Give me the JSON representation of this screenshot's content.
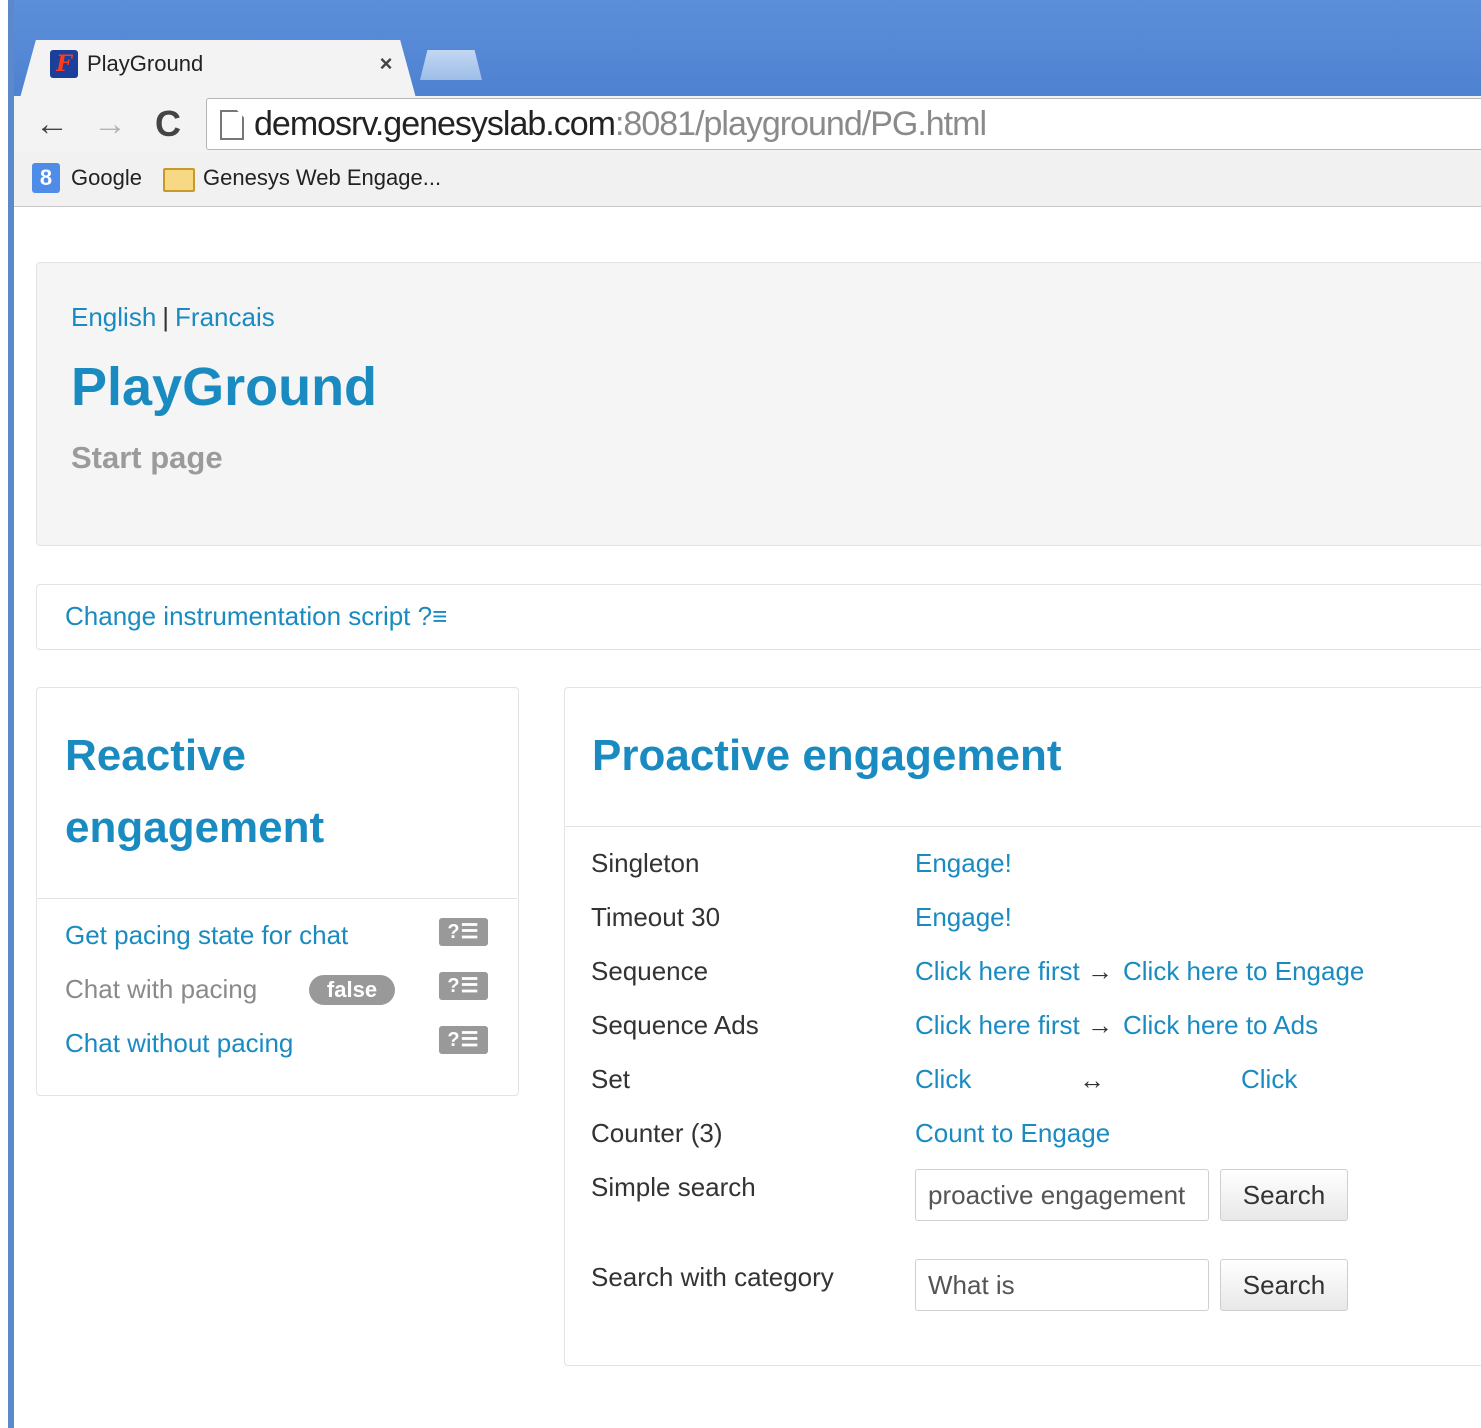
{
  "browser": {
    "tab_title": "PlayGround",
    "tab_close": "×",
    "favicon_glyph": "F",
    "url_host": "demosrv.genesyslab.com",
    "url_path": ":8081/playground/PG.html",
    "nav": {
      "back": "←",
      "forward": "→",
      "reload": "C"
    },
    "bookmarks": [
      {
        "label": "Google",
        "icon": "google-icon",
        "icon_glyph": "8"
      },
      {
        "label": "Genesys Web Engage...",
        "icon": "folder-icon"
      }
    ]
  },
  "header": {
    "lang_en": "English",
    "lang_sep": "|",
    "lang_fr": "Francais",
    "title": "PlayGround",
    "subtitle": "Start page"
  },
  "instrumentation": {
    "label": "Change instrumentation script ?≡"
  },
  "reactive": {
    "heading": "Reactive engagement",
    "help_glyph": "?☰",
    "items": [
      {
        "label": "Get pacing state for chat",
        "type": "link"
      },
      {
        "label": "Chat with pacing",
        "type": "static",
        "badge": "false"
      },
      {
        "label": "Chat without pacing",
        "type": "link"
      }
    ]
  },
  "proactive": {
    "heading": "Proactive engagement",
    "arrow": "→",
    "bidir_arrow": "↔",
    "rows": {
      "singleton": {
        "label": "Singleton",
        "action": "Engage!"
      },
      "timeout": {
        "label": "Timeout 30",
        "action": "Engage!"
      },
      "sequence": {
        "label": "Sequence",
        "first": "Click here first",
        "second": "Click here to Engage"
      },
      "sequence_ads": {
        "label": "Sequence Ads",
        "first": "Click here first",
        "second": "Click here to Ads"
      },
      "set": {
        "label": "Set",
        "first": "Click",
        "second": "Click"
      },
      "counter": {
        "label": "Counter (3)",
        "action": "Count to Engage"
      },
      "simple_search": {
        "label": "Simple search",
        "value": "proactive engagement",
        "button": "Search"
      },
      "category_search": {
        "label": "Search with category",
        "value": "What is",
        "button": "Search"
      }
    }
  },
  "colors": {
    "link": "#1a8bc1",
    "badge": "#999999",
    "chrome": "#4e82d2"
  }
}
